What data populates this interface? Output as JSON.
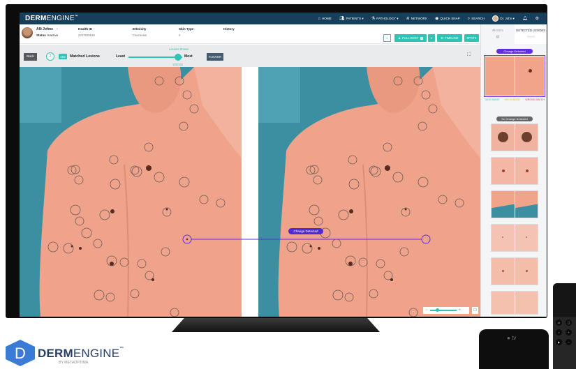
{
  "app": {
    "brand_bold": "DERM",
    "brand_light": "ENGINE",
    "brand_suffix": "™"
  },
  "nav": {
    "items": [
      {
        "icon": "home-icon",
        "label": "HOME"
      },
      {
        "icon": "patients-icon",
        "label": "PATIENTS ▾"
      },
      {
        "icon": "pathology-icon",
        "label": "PATHOLOGY ▾"
      },
      {
        "icon": "network-icon",
        "label": "NETWORK"
      },
      {
        "icon": "camera-icon",
        "label": "QUICK SNAP"
      },
      {
        "icon": "search-icon",
        "label": "SEARCH"
      }
    ],
    "user": "Dr. John ▾"
  },
  "patient": {
    "name": "Alli Johns",
    "gender_symbol": "♀",
    "status_label": "Status",
    "status_value": "Inactive",
    "columns": [
      {
        "header": "Health ID",
        "value": "2247825616"
      },
      {
        "header": "Ethnicity",
        "value": "Caucasian"
      },
      {
        "header": "Skin Type",
        "value": "II"
      },
      {
        "header": "History",
        "value": ""
      }
    ]
  },
  "actions": {
    "person_icon": "person-icon",
    "full_body_label": "FULL-BODY",
    "full_body_count": "3",
    "dropdown_label": "▾",
    "timeline_label": "TIMELINE",
    "spots_label": "SPOTS"
  },
  "toolbar": {
    "back_label": "Back",
    "circle_number": "2",
    "matched_count": "102",
    "matched_label": "Matched Lesions",
    "least_label": "Least",
    "most_label": "Most",
    "lesions_shown_caption": "Lesions Shown",
    "lesions_shown_count": "102/102",
    "lesions_shown_fraction": 1.0,
    "flicker_label": "FLICKER"
  },
  "compare": {
    "change_label": "Change Detected"
  },
  "zoom": {
    "minus": "−",
    "plus": "+"
  },
  "right_panel": {
    "tab_images": "IMAGES",
    "tab_detected": "DETECTED LESIONS",
    "tab_detected_sub": "○—○",
    "change_detected": "Change Detected",
    "no_change_detected": "No Change Detected",
    "take_image": "TAKE IMAGE",
    "no_change": "NO CHANGE",
    "wrong_match": "WRONG MATCH"
  },
  "footer": {
    "logo_letter": "D",
    "logo_bold": "DERM",
    "logo_light": "ENGINE",
    "logo_tm": "™",
    "logo_sub": "BY METAOPTIMA",
    "appletv_label": "tv"
  },
  "colors": {
    "nav_bg": "#163f5c",
    "accent_teal": "#2ec4b6",
    "change_purple": "#5f2de0",
    "skin": "#f0a48a",
    "backdrop": "#3c8fa1"
  }
}
